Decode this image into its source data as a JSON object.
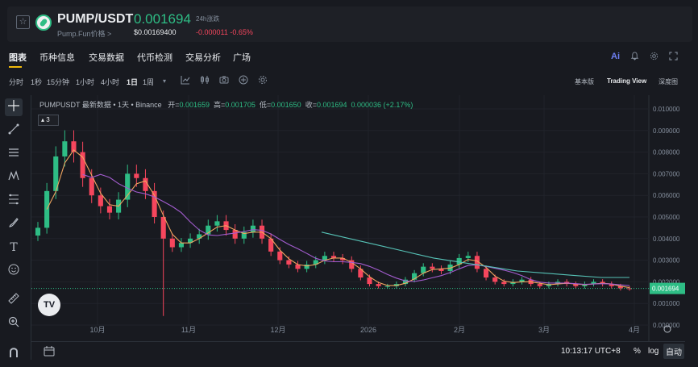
{
  "header": {
    "favorite_icon": "star-icon",
    "coin_icon": "pump-coin-icon",
    "symbol": "PUMP/USDT",
    "subname": "Pump.Fun价格 >",
    "price": "0.001694",
    "price_usd": "$0.00169400",
    "change_label": "24h涨跌",
    "change_value": "-0.000011 -0.65%"
  },
  "tabs": {
    "items": [
      "图表",
      "币种信息",
      "交易数据",
      "代币检测",
      "交易分析",
      "广场"
    ],
    "ai_label": "Ai",
    "icons": [
      "ai-icon",
      "bell-icon",
      "settings-icon",
      "fullscreen-icon"
    ]
  },
  "toolbar": {
    "intervals": [
      "分时",
      "1秒",
      "15分钟",
      "1小时",
      "4小时",
      "1日",
      "1周"
    ],
    "active_interval": "1日",
    "more_icon": "chevron-down-icon",
    "tool_icons": [
      "indicator-icon",
      "candle-type-icon",
      "camera-icon",
      "compare-icon",
      "settings-icon"
    ],
    "views": [
      "基本版",
      "Trading View",
      "深度图"
    ],
    "active_view": "Trading View"
  },
  "left_tools": [
    "crosshair-icon",
    "trendline-icon",
    "horizontal-lines-icon",
    "pattern-icon",
    "fib-icon",
    "brush-icon",
    "text-icon",
    "emoji-icon",
    "ruler-icon",
    "zoom-icon",
    "magnet-icon"
  ],
  "chart": {
    "legend_title": "PUMPUSDT 最新数据 • 1天 • Binance",
    "open_label": "开=",
    "open": "0.001659",
    "high_label": "高=",
    "high": "0.001705",
    "low_label": "低=",
    "low": "0.001650",
    "close_label": "收=",
    "close": "0.001694",
    "change": "0.000036 (+2.17%)",
    "indicator_badge": "3",
    "tv_logo": "TV",
    "last_price_tag": "0.001694",
    "colors": {
      "up": "#2ebd85",
      "down": "#f6465d",
      "ma_fast": "#f0a560",
      "ma_mid": "#a35ccf",
      "ma_slow": "#56c2b6",
      "background": "#181a20"
    }
  },
  "chart_data": {
    "type": "candlestick",
    "title": "",
    "xlabel": "",
    "ylabel": "",
    "y_ticks": [
      "0.000000",
      "0.001000",
      "0.002000",
      "0.003000",
      "0.004000",
      "0.005000",
      "0.006000",
      "0.007000",
      "0.008000",
      "0.009000",
      "0.010000"
    ],
    "ylim": [
      0.0,
      0.01
    ],
    "x_ticks": [
      "10月",
      "11月",
      "12月",
      "2026",
      "2月",
      "3月",
      "4月"
    ],
    "last_price": 0.001694,
    "close_series_approx": [
      0.0045,
      0.0062,
      0.0078,
      0.0085,
      0.008,
      0.0068,
      0.006,
      0.0055,
      0.0052,
      0.0058,
      0.007,
      0.0068,
      0.0062,
      0.005,
      0.004,
      0.0036,
      0.0038,
      0.004,
      0.0042,
      0.0046,
      0.0048,
      0.0044,
      0.004,
      0.0043,
      0.0046,
      0.004,
      0.0034,
      0.003,
      0.0028,
      0.0026,
      0.0028,
      0.003,
      0.0032,
      0.0031,
      0.003,
      0.0026,
      0.0022,
      0.0019,
      0.0018,
      0.0018,
      0.0019,
      0.0021,
      0.0024,
      0.0027,
      0.0026,
      0.0025,
      0.0028,
      0.0031,
      0.0032,
      0.0026,
      0.0022,
      0.002,
      0.0019,
      0.002,
      0.0021,
      0.0019,
      0.0018,
      0.0019,
      0.002,
      0.0019,
      0.0018,
      0.0019,
      0.002,
      0.0019,
      0.0018,
      0.0017,
      0.001694
    ],
    "ma_fast": {
      "color": "#f0a560"
    },
    "ma_mid": {
      "color": "#a35ccf"
    },
    "ma_slow": {
      "color": "#56c2b6",
      "values_approx": [
        0.0043,
        0.004,
        0.0037,
        0.0034,
        0.0031,
        0.0029,
        0.0027,
        0.0025,
        0.0024,
        0.0023,
        0.0022,
        0.0022
      ]
    }
  },
  "footer": {
    "date_range_icon": "calendar-range-icon",
    "clock": "10:13:17 UTC+8",
    "percent_label": "%",
    "log_label": "log",
    "auto_label": "自动"
  }
}
